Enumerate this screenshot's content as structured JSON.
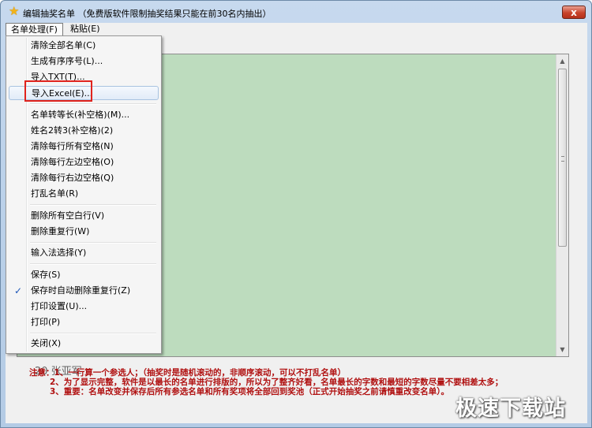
{
  "window": {
    "icon": "star-icon",
    "title": "编辑抽奖名单 （免费版软件限制抽奖结果只能在前30名内抽出）",
    "close_label": "x"
  },
  "menubar": {
    "items": [
      {
        "label": "名单处理(F)",
        "open": true
      },
      {
        "label": "粘贴(E)",
        "open": false
      }
    ]
  },
  "dropdown": {
    "items": [
      {
        "label": "清除全部名单(C)"
      },
      {
        "label": "生成有序序号(L)..."
      },
      {
        "label": "导入TXT(T)..."
      },
      {
        "label": "导入Excel(E)...",
        "highlighted": true
      },
      {
        "label": "名单转等长(补空格)(M)..."
      },
      {
        "label": "姓名2转3(补空格)(2)"
      },
      {
        "label": "清除每行所有空格(N)"
      },
      {
        "label": "清除每行左边空格(O)"
      },
      {
        "label": "清除每行右边空格(Q)"
      },
      {
        "label": "打乱名单(R)"
      },
      {
        "label": "删除所有空白行(V)"
      },
      {
        "label": "删除重复行(W)"
      },
      {
        "label": "输入法选择(Y)"
      },
      {
        "label": "保存(S)"
      },
      {
        "label": "保存时自动删除重复行(Z)",
        "checked": true
      },
      {
        "label": "打印设置(U)..."
      },
      {
        "label": "打印(P)"
      },
      {
        "label": "关闭(X)"
      }
    ]
  },
  "editor": {
    "partial_row": "20 张亚军",
    "background_color": "#bddcbe"
  },
  "notes": {
    "line1": "注意：1、一行算一个参选人；（抽奖时是随机滚动的，非顺序滚动，可以不打乱名单）",
    "line2": "2、为了显示完整，软件是以最长的名单进行排版的，所以为了整齐好看，名单最长的字数和最短的字数尽量不要相差太多；",
    "line3": "3、重要：名单改变并保存后所有参选名单和所有奖项将全部回到奖池（正式开始抽奖之前请慎重改变名单）。"
  },
  "watermark": "极速下载站",
  "colors": {
    "highlight_box": "#e0231d",
    "notes_text": "#b01010"
  }
}
